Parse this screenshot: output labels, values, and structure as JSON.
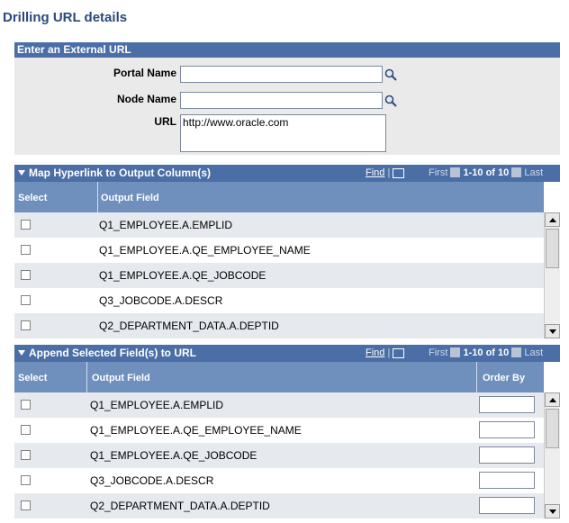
{
  "page_title": "Drilling URL details",
  "external": {
    "header": "Enter an External URL",
    "portal_label": "Portal Name",
    "portal_value": "",
    "node_label": "Node Name",
    "node_value": "",
    "url_label": "URL",
    "url_value": "http://www.oracle.com"
  },
  "grid1": {
    "title": "Map Hyperlink to Output Column(s)",
    "find": "Find",
    "sep": "|",
    "first": "First",
    "range": "1-10 of 10",
    "last": "Last",
    "col_select": "Select",
    "col_output": "Output Field",
    "rows": [
      {
        "field": "Q1_EMPLOYEE.A.EMPLID"
      },
      {
        "field": "Q1_EMPLOYEE.A.QE_EMPLOYEE_NAME"
      },
      {
        "field": "Q1_EMPLOYEE.A.QE_JOBCODE"
      },
      {
        "field": "Q3_JOBCODE.A.DESCR"
      },
      {
        "field": "Q2_DEPARTMENT_DATA.A.DEPTID"
      }
    ]
  },
  "grid2": {
    "title": "Append Selected Field(s) to URL",
    "find": "Find",
    "sep": "|",
    "first": "First",
    "range": "1-10 of 10",
    "last": "Last",
    "col_select": "Select",
    "col_output": "Output Field",
    "col_order": "Order By",
    "rows": [
      {
        "field": "Q1_EMPLOYEE.A.EMPLID"
      },
      {
        "field": "Q1_EMPLOYEE.A.QE_EMPLOYEE_NAME"
      },
      {
        "field": "Q1_EMPLOYEE.A.QE_JOBCODE"
      },
      {
        "field": "Q3_JOBCODE.A.DESCR"
      },
      {
        "field": "Q2_DEPARTMENT_DATA.A.DEPTID"
      }
    ]
  }
}
